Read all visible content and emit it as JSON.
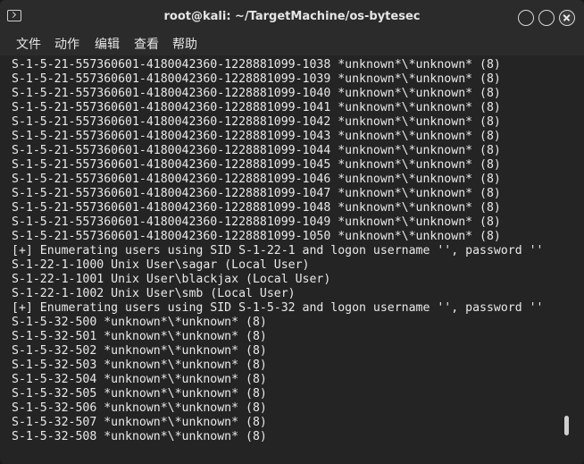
{
  "window": {
    "title": "root@kali: ~/TargetMachine/os-bytesec"
  },
  "menu": [
    "文件",
    "动作",
    "编辑",
    "查看",
    "帮助"
  ],
  "terminal_lines": [
    "S-1-5-21-557360601-4180042360-1228881099-1038 *unknown*\\*unknown* (8)",
    "S-1-5-21-557360601-4180042360-1228881099-1039 *unknown*\\*unknown* (8)",
    "S-1-5-21-557360601-4180042360-1228881099-1040 *unknown*\\*unknown* (8)",
    "S-1-5-21-557360601-4180042360-1228881099-1041 *unknown*\\*unknown* (8)",
    "S-1-5-21-557360601-4180042360-1228881099-1042 *unknown*\\*unknown* (8)",
    "S-1-5-21-557360601-4180042360-1228881099-1043 *unknown*\\*unknown* (8)",
    "S-1-5-21-557360601-4180042360-1228881099-1044 *unknown*\\*unknown* (8)",
    "S-1-5-21-557360601-4180042360-1228881099-1045 *unknown*\\*unknown* (8)",
    "S-1-5-21-557360601-4180042360-1228881099-1046 *unknown*\\*unknown* (8)",
    "S-1-5-21-557360601-4180042360-1228881099-1047 *unknown*\\*unknown* (8)",
    "S-1-5-21-557360601-4180042360-1228881099-1048 *unknown*\\*unknown* (8)",
    "S-1-5-21-557360601-4180042360-1228881099-1049 *unknown*\\*unknown* (8)",
    "S-1-5-21-557360601-4180042360-1228881099-1050 *unknown*\\*unknown* (8)",
    "[+] Enumerating users using SID S-1-22-1 and logon username '', password ''",
    "S-1-22-1-1000 Unix User\\sagar (Local User)",
    "S-1-22-1-1001 Unix User\\blackjax (Local User)",
    "S-1-22-1-1002 Unix User\\smb (Local User)",
    "[+] Enumerating users using SID S-1-5-32 and logon username '', password ''",
    "S-1-5-32-500 *unknown*\\*unknown* (8)",
    "S-1-5-32-501 *unknown*\\*unknown* (8)",
    "S-1-5-32-502 *unknown*\\*unknown* (8)",
    "S-1-5-32-503 *unknown*\\*unknown* (8)",
    "S-1-5-32-504 *unknown*\\*unknown* (8)",
    "S-1-5-32-505 *unknown*\\*unknown* (8)",
    "S-1-5-32-506 *unknown*\\*unknown* (8)",
    "S-1-5-32-507 *unknown*\\*unknown* (8)",
    "S-1-5-32-508 *unknown*\\*unknown* (8)"
  ],
  "icons": {
    "app": "terminal-icon",
    "minimize": "minimize-icon",
    "maximize": "maximize-icon",
    "close": "close-icon"
  },
  "colors": {
    "background": "#242424",
    "text": "#e9e9e9",
    "titlebar": "#2b2b2b"
  }
}
